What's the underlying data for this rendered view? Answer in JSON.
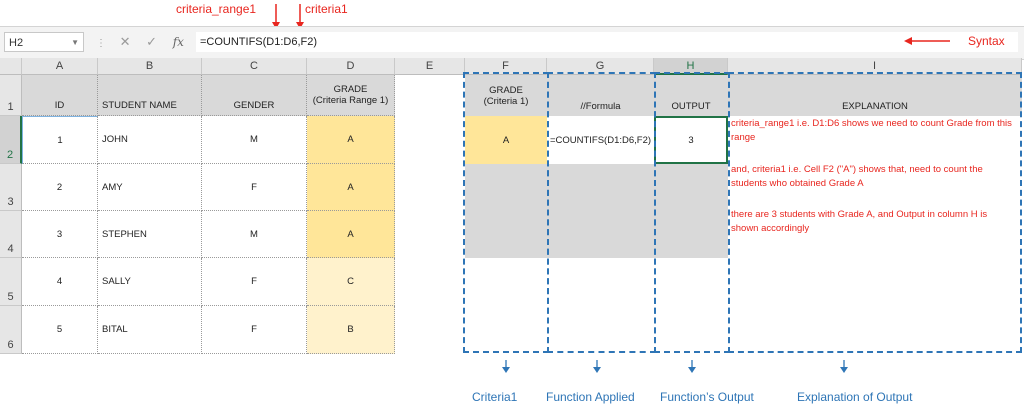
{
  "annotations": {
    "criteria_range1": "criteria_range1",
    "criteria1": "criteria1",
    "syntax": "Syntax"
  },
  "formula_bar": {
    "name_box": "H2",
    "icons": [
      "cancel-icon",
      "enter-icon",
      "fx-icon"
    ],
    "formula": "=COUNTIFS(D1:D6,F2)"
  },
  "columns": [
    "A",
    "B",
    "C",
    "D",
    "E",
    "F",
    "G",
    "H",
    "I"
  ],
  "rows": [
    "1",
    "2",
    "3",
    "4",
    "5",
    "6"
  ],
  "table": {
    "headers": {
      "id": "ID",
      "name": "STUDENT NAME",
      "gender": "GENDER",
      "grade_line1": "GRADE",
      "grade_line2": "(Criteria Range 1)"
    },
    "data": [
      {
        "id": "1",
        "name": "JOHN",
        "gender": "M",
        "grade": "A"
      },
      {
        "id": "2",
        "name": "AMY",
        "gender": "F",
        "grade": "A"
      },
      {
        "id": "3",
        "name": "STEPHEN",
        "gender": "M",
        "grade": "A"
      },
      {
        "id": "4",
        "name": "SALLY",
        "gender": "F",
        "grade": "C"
      },
      {
        "id": "5",
        "name": "BITAL",
        "gender": "F",
        "grade": "B"
      }
    ]
  },
  "right_table": {
    "f_header_line1": "GRADE",
    "f_header_line2": "(Criteria 1)",
    "g_header": "//Formula",
    "h_header": "OUTPUT",
    "i_header": "EXPLANATION",
    "f2": "A",
    "g2": "=COUNTIFS(D1:D6,F2)",
    "h2": "3",
    "explanation": [
      "criteria_range1 i.e. D1:D6 shows we need to count Grade from this range",
      "and, criteria1 i.e. Cell F2 (\"A\") shows that, need to count the students who obtained Grade A",
      "there are 3 students with Grade A, and Output in column H is shown accordingly"
    ]
  },
  "bottom_labels": {
    "criteria1": "Criteria1",
    "function_applied": "Function Applied",
    "function_output": "Function’s Output",
    "explanation_output": "Explanation of Output"
  },
  "colors": {
    "annotation_red": "#e8261f",
    "label_blue": "#2e75b6",
    "grade_a_fill": "#ffe699",
    "grade_other_fill": "#fff2cc",
    "header_fill": "#d9d9d9",
    "selection_green": "#217346"
  }
}
